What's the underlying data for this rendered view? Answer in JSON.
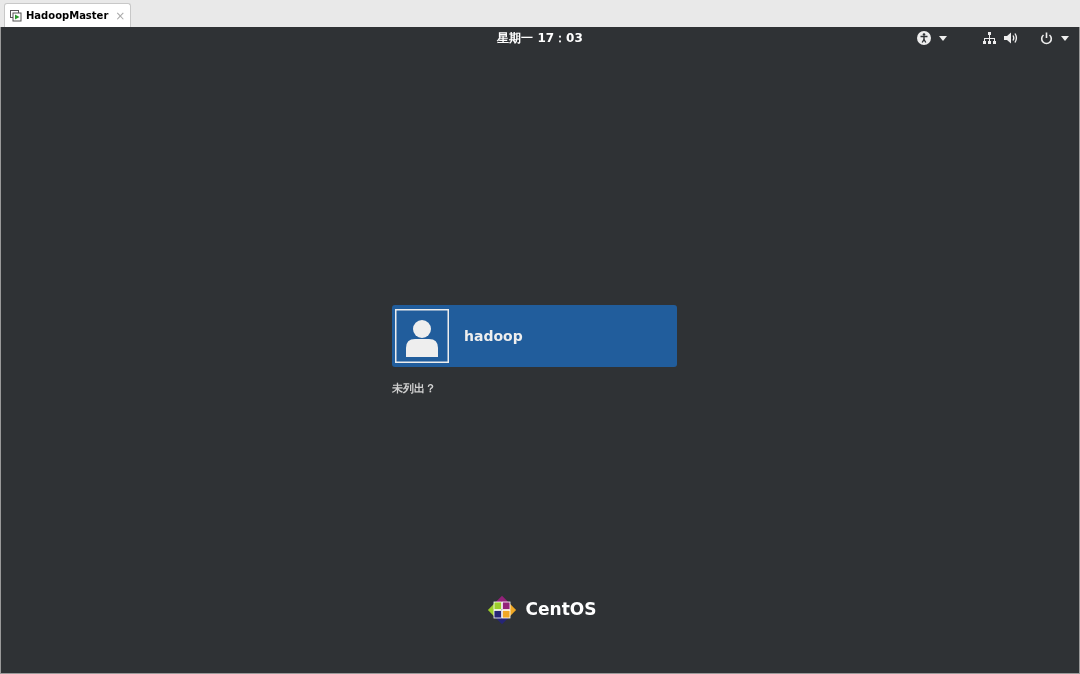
{
  "tab": {
    "title": "HadoopMaster",
    "close": "×"
  },
  "top_bar": {
    "clock": "星期一 17：03"
  },
  "users": [
    {
      "name": "hadoop",
      "selected": true
    }
  ],
  "not_listed_link": "未列出？",
  "logo": {
    "text": "CentOS"
  }
}
